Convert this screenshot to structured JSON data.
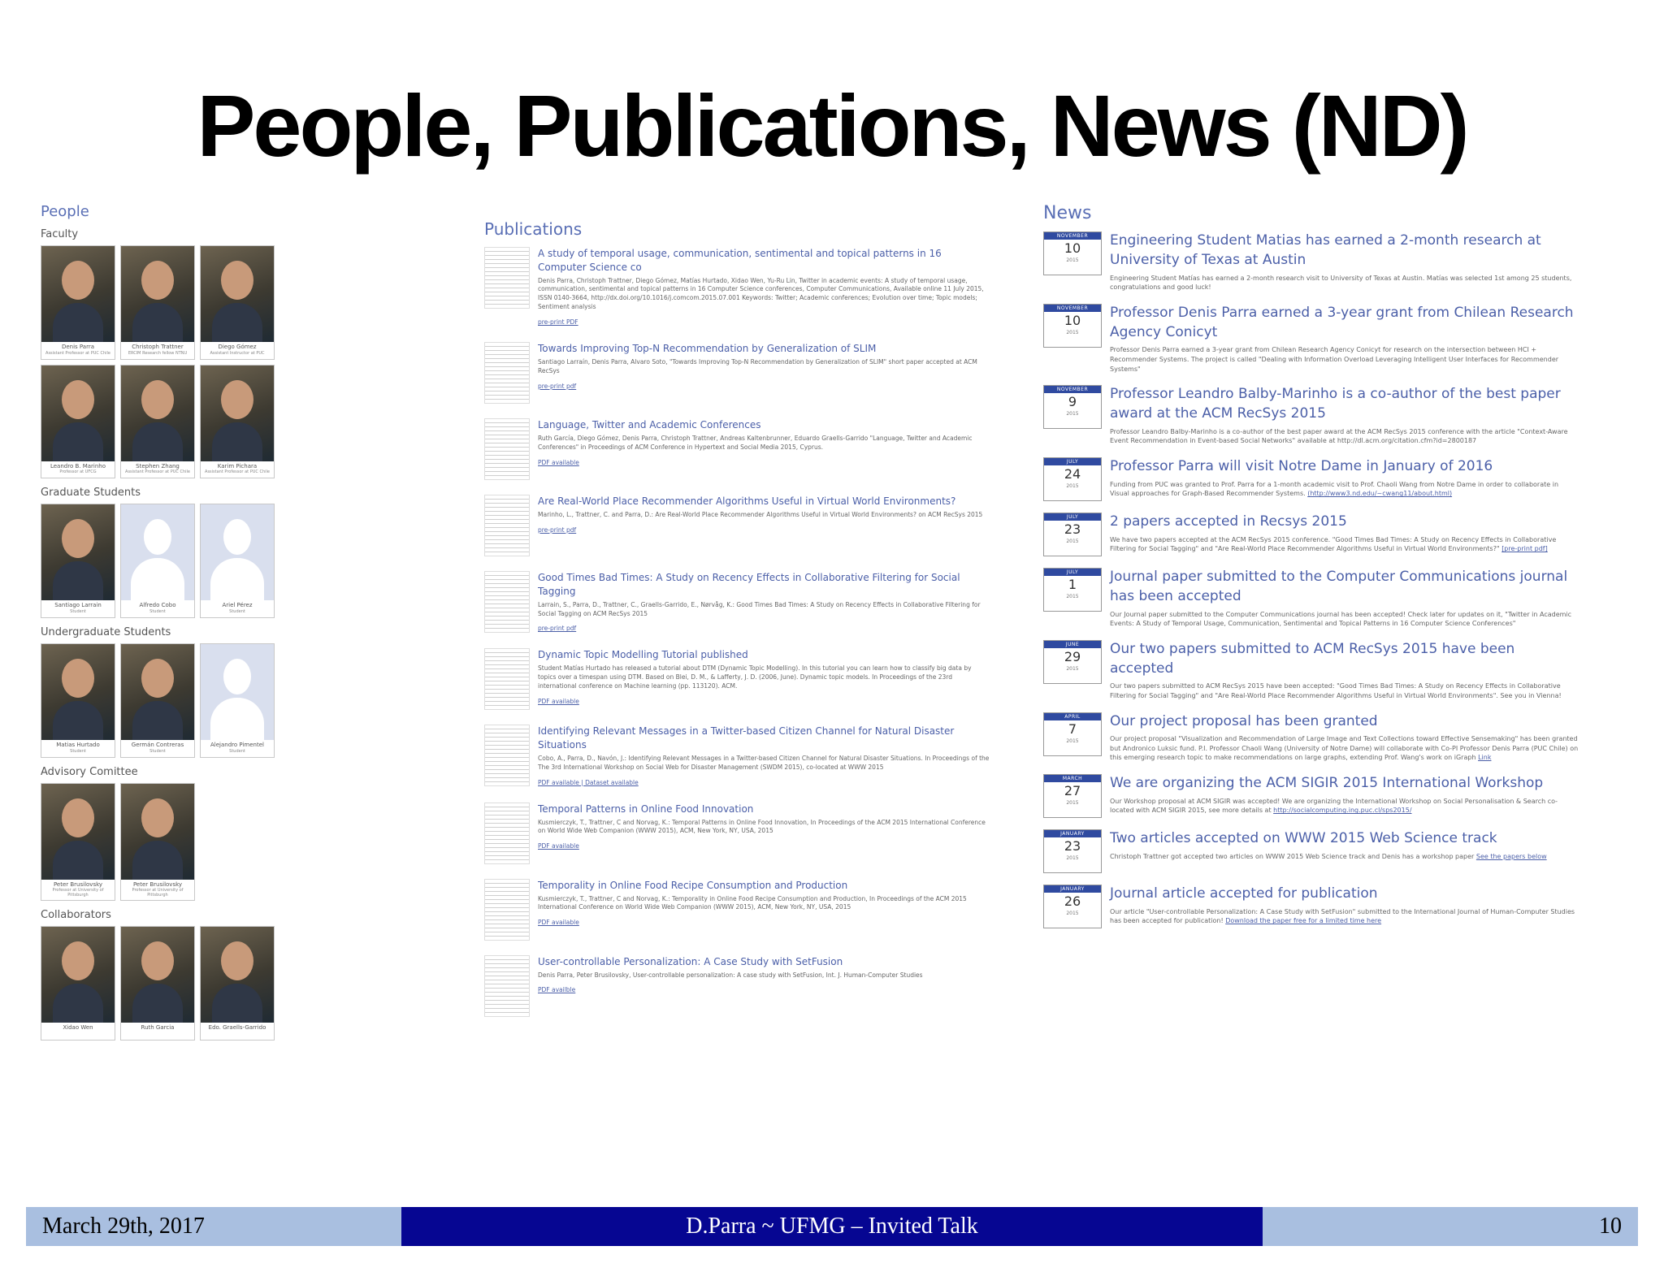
{
  "slide": {
    "title": "People, Publications, News (ND)"
  },
  "people": {
    "heading": "People",
    "groups": [
      {
        "label": "Faculty",
        "members": [
          {
            "name": "Denis Parra",
            "role": "Assistant Professor at PUC Chile",
            "photo": true
          },
          {
            "name": "Christoph Trattner",
            "role": "ERCIM Research fellow NTNU",
            "photo": true
          },
          {
            "name": "Diego Gómez",
            "role": "Assistant Instructor at PUC",
            "photo": true
          },
          {
            "name": "Leandro B. Marinho",
            "role": "Professor at UFCG",
            "photo": true
          },
          {
            "name": "Stephen Zhang",
            "role": "Assistant Professor at PUC Chile",
            "photo": true
          },
          {
            "name": "Karim Pichara",
            "role": "Assistant Professor at PUC Chile",
            "photo": true
          }
        ]
      },
      {
        "label": "Graduate Students",
        "members": [
          {
            "name": "Santiago Larrain",
            "role": "Student",
            "photo": true
          },
          {
            "name": "Alfredo Cobo",
            "role": "Student",
            "photo": false
          },
          {
            "name": "Ariel Pérez",
            "role": "Student",
            "photo": false
          }
        ]
      },
      {
        "label": "Undergraduate Students",
        "members": [
          {
            "name": "Matias Hurtado",
            "role": "Student",
            "photo": true
          },
          {
            "name": "Germán Contreras",
            "role": "Student",
            "photo": true
          },
          {
            "name": "Alejandro Pimentel",
            "role": "Student",
            "photo": false
          }
        ]
      },
      {
        "label": "Advisory Comittee",
        "members": [
          {
            "name": "Peter Brusilovsky",
            "role": "Professor at University of Pittsburgh",
            "photo": true
          },
          {
            "name": "Peter Brusilovsky",
            "role": "Professor at University of Pittsburgh",
            "photo": true
          }
        ]
      },
      {
        "label": "Collaborators",
        "members": [
          {
            "name": "Xidao Wen",
            "role": "",
            "photo": true
          },
          {
            "name": "Ruth Garcia",
            "role": "",
            "photo": true
          },
          {
            "name": "Edo. Graells-Garrido",
            "role": "",
            "photo": true
          }
        ]
      }
    ]
  },
  "publications": {
    "heading": "Publications",
    "items": [
      {
        "title": "A study of temporal usage, communication, sentimental and topical patterns in 16 Computer Science co",
        "desc": "Denis Parra, Christoph Trattner, Diego Gómez, Matías Hurtado, Xidao Wen, Yu-Ru Lin, Twitter in academic events: A study of temporal usage, communication, sentimental and topical patterns in 16 Computer Science conferences, Computer Communications, Available online 11 July 2015, ISSN 0140-3664, http://dx.doi.org/10.1016/j.comcom.2015.07.001 Keywords: Twitter; Academic conferences; Evolution over time; Topic models; Sentiment analysis",
        "link": "pre-print PDF"
      },
      {
        "title": "Towards Improving Top-N Recommendation by Generalization of SLIM",
        "desc": "Santiago Larraín, Denis Parra, Alvaro Soto, \"Towards Improving Top-N Recommendation by Generalization of SLIM\" short paper accepted at ACM RecSys",
        "link": "pre-print pdf"
      },
      {
        "title": "Language, Twitter and Academic Conferences",
        "desc": "Ruth García, Diego Gómez, Denis Parra, Christoph Trattner, Andreas Kaltenbrunner, Eduardo Graells-Garrido \"Language, Twitter and Academic Conferences\" in Proceedings of ACM Conference in Hypertext and Social Media 2015, Cyprus.",
        "link": "PDF available"
      },
      {
        "title": "Are Real-World Place Recommender Algorithms Useful in Virtual World Environments?",
        "desc": "Marinho, L., Trattner, C. and Parra, D.: Are Real-World Place Recommender Algorithms Useful in Virtual World Environments? on ACM RecSys 2015",
        "link": "pre-print pdf"
      },
      {
        "title": "Good Times Bad Times: A Study on Recency Effects in Collaborative Filtering for Social Tagging",
        "desc": "Larrain, S., Parra, D., Trattner, C., Graells-Garrido, E., Nørvåg, K.: Good Times Bad Times: A Study on Recency Effects in Collaborative Filtering for Social Tagging on ACM RecSys 2015",
        "link": "pre-print pdf"
      },
      {
        "title": "Dynamic Topic Modelling Tutorial published",
        "desc": "Student Matías Hurtado has released a tutorial about DTM (Dynamic Topic Modelling). In this tutorial you can learn how to classify big data by topics over a timespan using DTM. Based on Blei, D. M., & Lafferty, J. D. (2006, June). Dynamic topic models. In Proceedings of the 23rd international conference on Machine learning (pp. 113120). ACM.",
        "link": "PDF available"
      },
      {
        "title": "Identifying Relevant Messages in a Twitter-based Citizen Channel for Natural Disaster Situations",
        "desc": "Cobo, A., Parra, D., Navón, J.: Identifying Relevant Messages in a Twitter-based Citizen Channel for Natural Disaster Situations. In Proceedings of the The 3rd International Workshop on Social Web for Disaster Management (SWDM 2015), co-located at WWW 2015",
        "link": "PDF available | Dataset available"
      },
      {
        "title": "Temporal Patterns in Online Food Innovation",
        "desc": "Kusmierczyk, T., Trattner, C and Norvag, K.: Temporal Patterns in Online Food Innovation, In Proceedings of the ACM 2015 International Conference on World Wide Web Companion (WWW 2015), ACM, New York, NY, USA, 2015",
        "link": "PDF available"
      },
      {
        "title": "Temporality in Online Food Recipe Consumption and Production",
        "desc": "Kusmierczyk, T., Trattner, C and Norvag, K.: Temporality in Online Food Recipe Consumption and Production, In Proceedings of the ACM 2015 International Conference on World Wide Web Companion (WWW 2015), ACM, New York, NY, USA, 2015",
        "link": "PDF available"
      },
      {
        "title": "User-controllable Personalization: A Case Study with SetFusion",
        "desc": "Denis Parra, Peter Brusilovsky, User-controllable personalization: A case study with SetFusion, Int. J. Human-Computer Studies",
        "link": "PDF availble"
      }
    ]
  },
  "news": {
    "heading": "News",
    "items": [
      {
        "month": "NOVEMBER",
        "day": "10",
        "year": "2015",
        "title": "Engineering Student Matias has earned a 2-month research at University of Texas at Austin",
        "desc": "Engineering Student Matías has earned a 2-month research visit to University of Texas at Austin. Matías was selected 1st among 25 students, congratulations and good luck!",
        "link": ""
      },
      {
        "month": "NOVEMBER",
        "day": "10",
        "year": "2015",
        "title": "Professor Denis Parra earned a 3-year grant from Chilean Research Agency Conicyt",
        "desc": "Professor Denis Parra earned a 3-year grant from Chilean Research Agency Conicyt for research on the intersection between HCI + Recommender Systems. The project is called \"Dealing with Information Overload Leveraging Intelligent User Interfaces for Recommender Systems\"",
        "link": ""
      },
      {
        "month": "NOVEMBER",
        "day": "9",
        "year": "2015",
        "title": "Professor Leandro Balby-Marinho is a co-author of the best paper award at the ACM RecSys 2015",
        "desc": "Professor Leandro Balby-Marinho is a co-author of the best paper award at the ACM RecSys 2015 conference with the article \"Context-Aware Event Recommendation in Event-based Social Networks\" available at http://dl.acm.org/citation.cfm?id=2800187",
        "link": ""
      },
      {
        "month": "JULY",
        "day": "24",
        "year": "2015",
        "title": "Professor Parra will visit Notre Dame in January of 2016",
        "desc": "Funding from PUC was granted to Prof. Parra for a 1-month academic visit to Prof. Chaoli Wang from Notre Dame in order to collaborate in Visual approaches for Graph-Based Recommender Systems.",
        "link": "(http://www3.nd.edu/~cwang11/about.html)"
      },
      {
        "month": "JULY",
        "day": "23",
        "year": "2015",
        "title": "2 papers accepted in Recsys 2015",
        "desc": "We have two papers accepted at the ACM RecSys 2015 conference. \"Good Times Bad Times: A Study on Recency Effects in Collaborative Filtering for Social Tagging\" and \"Are Real-World Place Recommender Algorithms Useful in Virtual World Environments?\"",
        "link": "[pre-print pdf]"
      },
      {
        "month": "JULY",
        "day": "1",
        "year": "2015",
        "title": "Journal paper submitted to the Computer Communications journal has been accepted",
        "desc": "Our Journal paper submitted to the Computer Communications journal has been accepted! Check later for updates on it, \"Twitter in Academic Events: A Study of Temporal Usage, Communication, Sentimental and Topical Patterns in 16 Computer Science Conferences\"",
        "link": ""
      },
      {
        "month": "JUNE",
        "day": "29",
        "year": "2015",
        "title": "Our two papers submitted to ACM RecSys 2015 have been accepted",
        "desc": "Our two papers submitted to ACM RecSys 2015 have been accepted: \"Good Times Bad Times: A Study on Recency Effects in Collaborative Filtering for Social Tagging\" and \"Are Real-World Place Recommender Algorithms Useful in Virtual World Environments\". See you in Vienna!",
        "link": ""
      },
      {
        "month": "APRIL",
        "day": "7",
        "year": "2015",
        "title": "Our project proposal has been granted",
        "desc": "Our project proposal \"Visualization and Recommendation of Large Image and Text Collections toward Effective Sensemaking\" has been granted but Andronico Luksic fund. P.I. Professor Chaoli Wang (University of Notre Dame) will collaborate with Co-PI Professor Denis Parra (PUC Chile) on this emerging research topic to make recommendations on large graphs, extending Prof. Wang's work on iGraph",
        "link": "Link"
      },
      {
        "month": "MARCH",
        "day": "27",
        "year": "2015",
        "title": "We are organizing the ACM SIGIR 2015 International Workshop",
        "desc": "Our Workshop proposal at ACM SIGIR was accepted! We are organizing the International Workshop on Social Personalisation & Search co-located with ACM SIGIR 2015, see more details at",
        "link": "http://socialcomputing.ing.puc.cl/sps2015/"
      },
      {
        "month": "JANUARY",
        "day": "23",
        "year": "2015",
        "title": "Two articles accepted on WWW 2015 Web Science track",
        "desc": "Christoph Trattner got accepted two articles on WWW 2015 Web Science track and Denis has a workshop paper",
        "link": "See the papers below"
      },
      {
        "month": "JANUARY",
        "day": "26",
        "year": "2015",
        "title": "Journal article accepted for publication",
        "desc": "Our article \"User-controllable Personalization: A Case Study with SetFusion\" submitted to the International Journal of Human-Computer Studies has been accepted for publication!",
        "link": "Download the paper free for a limited time here"
      }
    ]
  },
  "footer": {
    "date": "March 29th, 2017",
    "center": "D.Parra ~ UFMG – Invited Talk",
    "page": "10"
  },
  "colors": {
    "accent_link": "#4b5fa8",
    "footer_center_bg": "#060692",
    "footer_side_bg": "#a9bfe0",
    "calendar_header": "#2f4aa0"
  }
}
